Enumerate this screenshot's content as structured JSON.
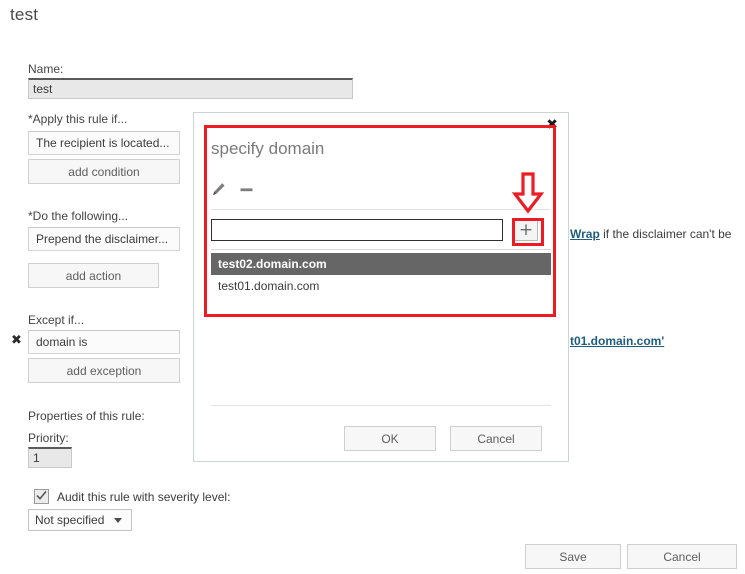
{
  "page": {
    "title": "test"
  },
  "form": {
    "name_label": "Name:",
    "name_value": "test",
    "apply_label": "*Apply this rule if...",
    "apply_condition": "The recipient is located...",
    "add_condition_label": "add condition",
    "do_following_label": "*Do the following...",
    "action_value": "Prepend the disclaimer...",
    "add_action_label": "add action",
    "except_label": "Except if...",
    "exception_value": "domain is",
    "add_exception_label": "add exception",
    "delete_exception_icon": "✖",
    "properties_label": "Properties of this rule:",
    "priority_label": "Priority:",
    "priority_value": "1",
    "audit_label": "Audit this rule with severity level:",
    "audit_checked": true,
    "severity_value": "Not specified"
  },
  "hints": {
    "wrap_link": "Wrap",
    "wrap_rest": " if the disclaimer can't be",
    "domain_link": "t01.domain.com'"
  },
  "footer": {
    "save_label": "Save",
    "cancel_label": "Cancel"
  },
  "dialog": {
    "title": "specify domain",
    "close_icon": "✖",
    "edit_icon": "pencil-icon",
    "remove_icon": "minus-icon",
    "input_value": "",
    "input_placeholder": "",
    "add_button_glyph": "+",
    "list_items": [
      {
        "label": "test02.domain.com",
        "selected": true
      },
      {
        "label": "test01.domain.com",
        "selected": false
      }
    ],
    "ok_label": "OK",
    "cancel_label": "Cancel"
  },
  "annotations": {
    "highlight_color": "#ec1c24",
    "arrow_direction": "down",
    "arrow_target": "add-domain-plus-button"
  }
}
